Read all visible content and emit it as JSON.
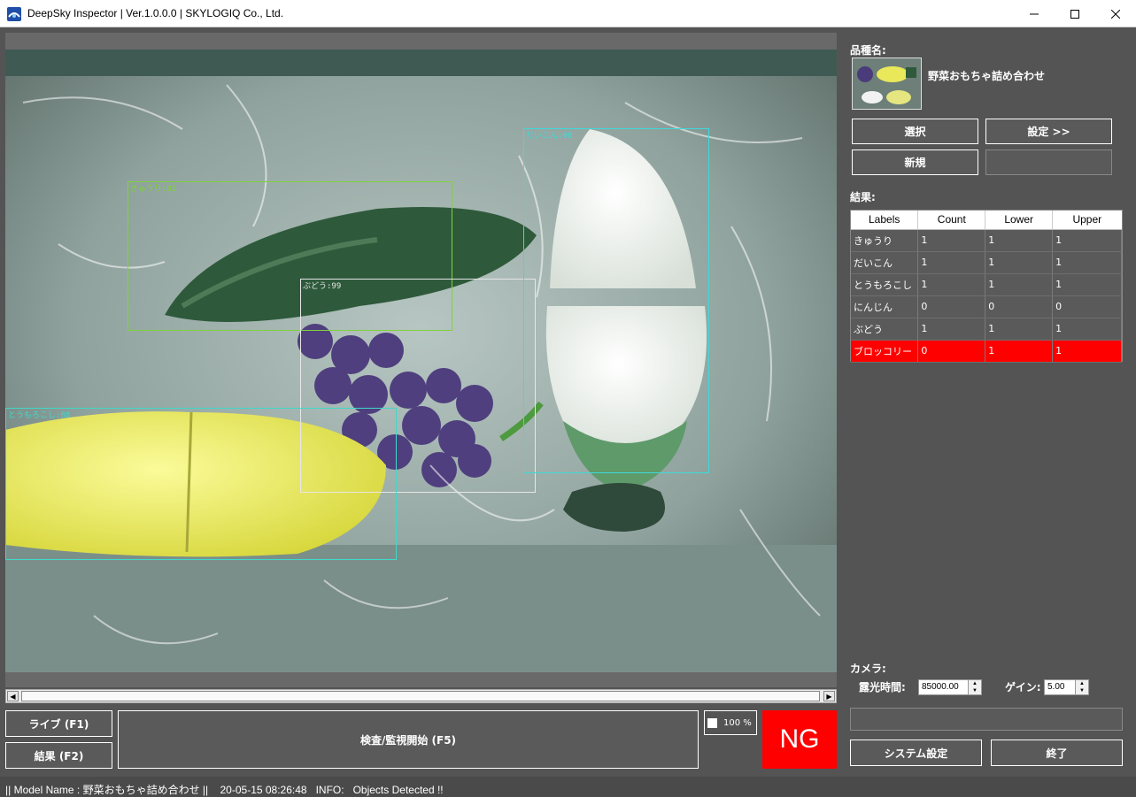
{
  "window": {
    "title": "DeepSky Inspector | Ver.1.0.0.0 | SKYLOGIQ Co., Ltd.",
    "minimize": "—",
    "maximize": "☐",
    "close": "✕"
  },
  "viewer": {
    "detections": [
      {
        "label": "きゅうり:82",
        "color": "#7fd23a"
      },
      {
        "label": "ぶどう:99",
        "color": "#e6e6e6"
      },
      {
        "label": "だいこん:98",
        "color": "#3fd9d9"
      },
      {
        "label": "とうもろこし:88",
        "color": "#3fd9c9"
      }
    ],
    "scroll_left": "◀",
    "scroll_right": "▶"
  },
  "controls": {
    "live_button": "ライブ (F1)",
    "result_button": "結果 (F2)",
    "inspect_button": "検査/監視開始 (F5)",
    "zoom": "100 %",
    "judgement": "NG"
  },
  "product": {
    "label": "品種名:",
    "name": "野菜おもちゃ詰め合わせ",
    "select_button": "選択",
    "settings_button": "設定 >>",
    "new_button": "新規"
  },
  "results": {
    "label": "結果:",
    "columns": [
      "Labels",
      "Count",
      "Lower",
      "Upper"
    ],
    "rows": [
      {
        "label": "きゅうり",
        "count": "1",
        "lower": "1",
        "upper": "1",
        "ng": false
      },
      {
        "label": "だいこん",
        "count": "1",
        "lower": "1",
        "upper": "1",
        "ng": false
      },
      {
        "label": "とうもろこし",
        "count": "1",
        "lower": "1",
        "upper": "1",
        "ng": false
      },
      {
        "label": "にんじん",
        "count": "0",
        "lower": "0",
        "upper": "0",
        "ng": false
      },
      {
        "label": "ぶどう",
        "count": "1",
        "lower": "1",
        "upper": "1",
        "ng": false
      },
      {
        "label": "ブロッコリー",
        "count": "0",
        "lower": "1",
        "upper": "1",
        "ng": true
      }
    ]
  },
  "camera": {
    "label": "カメラ:",
    "exposure_label": "露光時間:",
    "exposure_value": "85000.00",
    "gain_label": "ゲイン:",
    "gain_value": "5.00"
  },
  "footer_buttons": {
    "system_settings": "システム設定",
    "exit": "終了"
  },
  "status_bar": {
    "text": "|| Model Name : 野菜おもちゃ詰め合わせ ||    20-05-15 08:26:48   INFO:   Objects Detected !!"
  }
}
